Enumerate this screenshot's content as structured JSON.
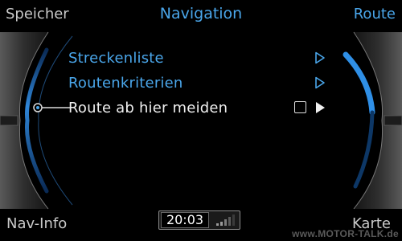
{
  "top_bar": {
    "left": "Speicher",
    "center": "Navigation",
    "right": "Route"
  },
  "menu": {
    "items": [
      {
        "label": "Streckenliste",
        "state": "link",
        "arrow": "outline-triangle-right"
      },
      {
        "label": "Routenkriterien",
        "state": "link",
        "arrow": "outline-triangle-right"
      },
      {
        "label": "Route ab hier meiden",
        "state": "selected",
        "checkbox_checked": false,
        "arrow": "filled-triangle-right"
      }
    ]
  },
  "bottom_bar": {
    "left": "Nav-Info",
    "right": "Karte",
    "clock": "20:03",
    "signal_icon": "signal-bars-icon"
  },
  "watermark": "www.MOTOR-TALK.de",
  "colors": {
    "accent": "#4aa6ea",
    "text": "#e8e8e8",
    "background": "#000000"
  }
}
